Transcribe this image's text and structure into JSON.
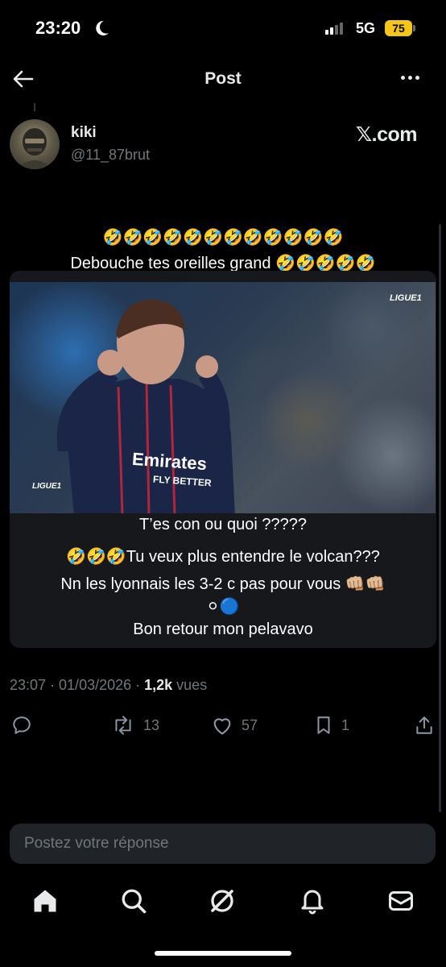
{
  "status_bar": {
    "time": "23:20",
    "network": "5G",
    "battery": "75",
    "battery_color": "#f5c518"
  },
  "header": {
    "title": "Post",
    "back_icon": "arrow-left-icon",
    "more_icon": "more-horizontal-icon"
  },
  "author": {
    "name": "kiki",
    "handle": "@11_87brut",
    "source": "𝕏.com"
  },
  "post": {
    "emoji_line": "🤣🤣🤣🤣🤣🤣🤣🤣🤣🤣🤣🤣",
    "caption_1": "Debouche tes oreilles grand 🤣🤣🤣🤣🤣",
    "caption_2": "T’es con ou quoi ?????",
    "caption_3": "🤣🤣🤣Tu veux plus entendre le volcan???",
    "caption_4": "Nn les lyonnais les 3-2 c pas pour vous 👊🏼👊🏼",
    "caption_5": "⚪🔵",
    "caption_6": "Bon retour mon pelavavo",
    "video": {
      "logo_top": "LIGUE1",
      "logo_bottom": "LIGUE1",
      "jersey_line1": "Emirates",
      "jersey_line2": "FLY BETTER"
    }
  },
  "meta": {
    "timestamp": "23:07 · 01/03/2026 · ",
    "views_count": "1,2k",
    "views_label": " vues"
  },
  "actions": {
    "reply_icon": "comment-icon",
    "repost_icon": "repost-icon",
    "repost_count": "13",
    "like_icon": "heart-icon",
    "like_count": "57",
    "bookmark_icon": "bookmark-icon",
    "bookmark_count": "1",
    "share_icon": "share-icon"
  },
  "reply_box": {
    "placeholder": "Postez votre réponse"
  },
  "tabbar": {
    "items": [
      "home-icon",
      "search-icon",
      "grok-icon",
      "notifications-icon",
      "messages-icon"
    ]
  },
  "colors": {
    "background": "#000000",
    "text_primary": "#e7e9ea",
    "text_secondary": "#71767b",
    "card": "#16181c",
    "input": "#202327"
  }
}
